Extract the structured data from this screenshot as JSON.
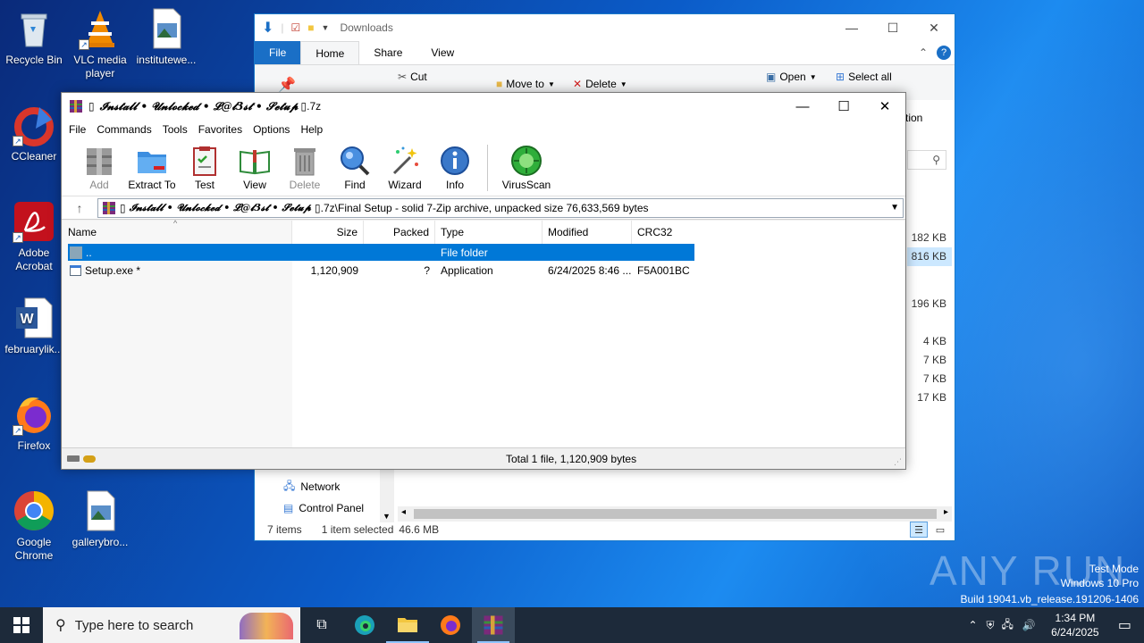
{
  "desktop": {
    "icons": [
      {
        "label": "Recycle Bin",
        "icon": "recycle-bin-icon"
      },
      {
        "label": "VLC media player",
        "icon": "vlc-icon"
      },
      {
        "label": "institutewe...",
        "icon": "image-file-icon"
      },
      {
        "label": "CCleaner",
        "icon": "ccleaner-icon"
      },
      {
        "label": "Adobe Acrobat",
        "icon": "adobe-acrobat-icon"
      },
      {
        "label": "februarylik...",
        "icon": "word-document-icon"
      },
      {
        "label": "Firefox",
        "icon": "firefox-icon"
      },
      {
        "label": "Google Chrome",
        "icon": "chrome-icon"
      },
      {
        "label": "gallerybro...",
        "icon": "image-file-icon"
      }
    ]
  },
  "explorer": {
    "title": "Downloads",
    "tabs": [
      "File",
      "Home",
      "Share",
      "View"
    ],
    "ribbon": {
      "cut": "Cut",
      "move_to": "Move to",
      "delete": "Delete",
      "open": "Open",
      "select_all": "Select all",
      "tion": "tion"
    },
    "sizes": [
      "182 KB",
      "816 KB",
      "",
      "196 KB",
      "",
      "4 KB",
      "7 KB",
      "7 KB",
      "17 KB"
    ],
    "nav": [
      {
        "label": "Network",
        "icon": "network-icon"
      },
      {
        "label": "Control Panel",
        "icon": "control-panel-icon"
      }
    ],
    "status": {
      "count": "7 items",
      "selected": "1 item selected",
      "size": "46.6 MB"
    }
  },
  "winrar": {
    "title_fancy": "𝓘𝓷𝓼𝓽𝓪𝓵𝓵 • 𝓤𝓷𝓵𝓸𝓬𝓴𝓮𝓭 • 𝓛@𝓽3𝓼𝓽 • 𝓢𝓮𝓽𝓾𝓹",
    "title_ext": ".7z",
    "menu": [
      "File",
      "Commands",
      "Tools",
      "Favorites",
      "Options",
      "Help"
    ],
    "toolbar": [
      {
        "label": "Add",
        "icon": "add-archive-icon",
        "disabled": true
      },
      {
        "label": "Extract To",
        "icon": "extract-folder-icon",
        "disabled": false
      },
      {
        "label": "Test",
        "icon": "test-clipboard-icon",
        "disabled": false
      },
      {
        "label": "View",
        "icon": "view-book-icon",
        "disabled": false
      },
      {
        "label": "Delete",
        "icon": "trash-can-icon",
        "disabled": true
      },
      {
        "label": "Find",
        "icon": "magnifier-icon",
        "disabled": false
      },
      {
        "label": "Wizard",
        "icon": "magic-wand-icon",
        "disabled": false
      },
      {
        "label": "Info",
        "icon": "info-icon",
        "disabled": false
      }
    ],
    "virusscan": {
      "label": "VirusScan",
      "icon": "virus-scan-icon"
    },
    "address": {
      "fancy": "𝓘𝓷𝓼𝓽𝓪𝓵𝓵 • 𝓤𝓷𝓵𝓸𝓬𝓴𝓮𝓭 • 𝓛@𝓽3𝓼𝓽 • 𝓢𝓮𝓽𝓾𝓹",
      "rest": ".7z\\Final Setup - solid 7-Zip archive, unpacked size 76,633,569 bytes"
    },
    "columns": [
      "Name",
      "Size",
      "Packed",
      "Type",
      "Modified",
      "CRC32"
    ],
    "rows": [
      {
        "name": "..",
        "size": "",
        "packed": "",
        "type": "File folder",
        "modified": "",
        "crc": "",
        "selected": true
      },
      {
        "name": "Setup.exe *",
        "size": "1,120,909",
        "packed": "?",
        "type": "Application",
        "modified": "6/24/2025 8:46 ...",
        "crc": "F5A001BC",
        "selected": false
      }
    ],
    "status": "Total 1 file, 1,120,909 bytes"
  },
  "watermark": {
    "brand": "ANY RUN",
    "line1": "Test Mode",
    "line2": "Windows 10 Pro",
    "line3": "Build 19041.vb_release.191206-1406"
  },
  "taskbar": {
    "search_placeholder": "Type here to search",
    "time": "1:34 PM",
    "date": "6/24/2025"
  }
}
